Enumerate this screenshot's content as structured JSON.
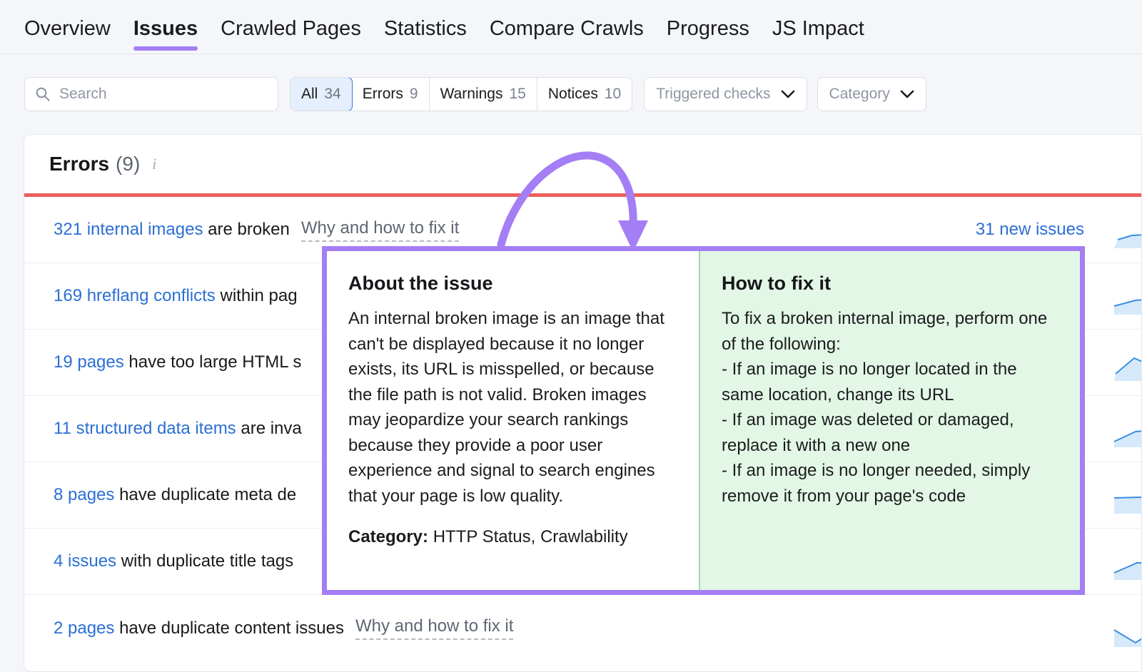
{
  "nav": {
    "tabs": [
      {
        "label": "Overview",
        "active": false
      },
      {
        "label": "Issues",
        "active": true
      },
      {
        "label": "Crawled Pages",
        "active": false
      },
      {
        "label": "Statistics",
        "active": false
      },
      {
        "label": "Compare Crawls",
        "active": false
      },
      {
        "label": "Progress",
        "active": false
      },
      {
        "label": "JS Impact",
        "active": false
      }
    ]
  },
  "filters": {
    "search": {
      "value": "",
      "placeholder": "Search"
    },
    "segments": [
      {
        "label": "All",
        "count": "34",
        "selected": true
      },
      {
        "label": "Errors",
        "count": "9",
        "selected": false
      },
      {
        "label": "Warnings",
        "count": "15",
        "selected": false
      },
      {
        "label": "Notices",
        "count": "10",
        "selected": false
      }
    ],
    "dropdowns": [
      {
        "label": "Triggered checks"
      },
      {
        "label": "Category"
      }
    ]
  },
  "card": {
    "title": "Errors",
    "count": "(9)",
    "info_icon": "i",
    "severity_color": "#ec5f5c",
    "rows": [
      {
        "count_link": "321 internal images",
        "rest": " are broken",
        "fix_link": "Why and how to fix it",
        "new_issues": "31 new issues",
        "spark": "55,40 75,34 95,33 120,36"
      },
      {
        "count_link": "169 hreflang conflicts",
        "rest": " within pag",
        "fix_link": "",
        "new_issues": "",
        "spark": "50,40 80,32 105,30 120,30"
      },
      {
        "count_link": "19 pages",
        "rest": " have too large HTML s",
        "fix_link": "",
        "new_issues": "",
        "spark": "52,42 78,20 110,34 120,38"
      },
      {
        "count_link": "11 structured data items",
        "rest": " are inva",
        "fix_link": "",
        "new_issues": "",
        "spark": "50,44 80,30 104,28 120,31"
      },
      {
        "count_link": "8 pages",
        "rest": " have duplicate meta de",
        "fix_link": "",
        "new_issues": "",
        "spark": "50,30 86,29 108,32 120,36"
      },
      {
        "count_link": "4 issues",
        "rest": " with duplicate title tags",
        "fix_link": "",
        "new_issues": "",
        "spark": "50,42 82,28 106,28 120,30"
      },
      {
        "count_link": "2 pages",
        "rest": " have duplicate content issues",
        "fix_link": "Why and how to fix it",
        "new_issues": "",
        "spark": "50,28 80,46 104,30 120,26"
      }
    ]
  },
  "tooltip": {
    "about_heading": "About the issue",
    "about_body": "An internal broken image is an image that can't be displayed because it no longer exists, its URL is misspelled, or because the file path is not valid. Broken images may jeopardize your search rankings because they provide a poor user experience and signal to search engines that your page is low quality.",
    "category_label": "Category:",
    "category_value": " HTTP Status, Crawlability",
    "fix_heading": "How to fix it",
    "fix_body": "To fix a broken internal image, perform one of the following:\n- If an image is no longer located in the same location, change its URL\n- If an image was deleted or damaged, replace it with a new one\n- If an image is no longer needed, simply remove it from your page's code",
    "border_color": "#a47ef5",
    "fix_bg_color": "#e3f7e6"
  },
  "annotation": {
    "arrow_color": "#a47ef5"
  }
}
